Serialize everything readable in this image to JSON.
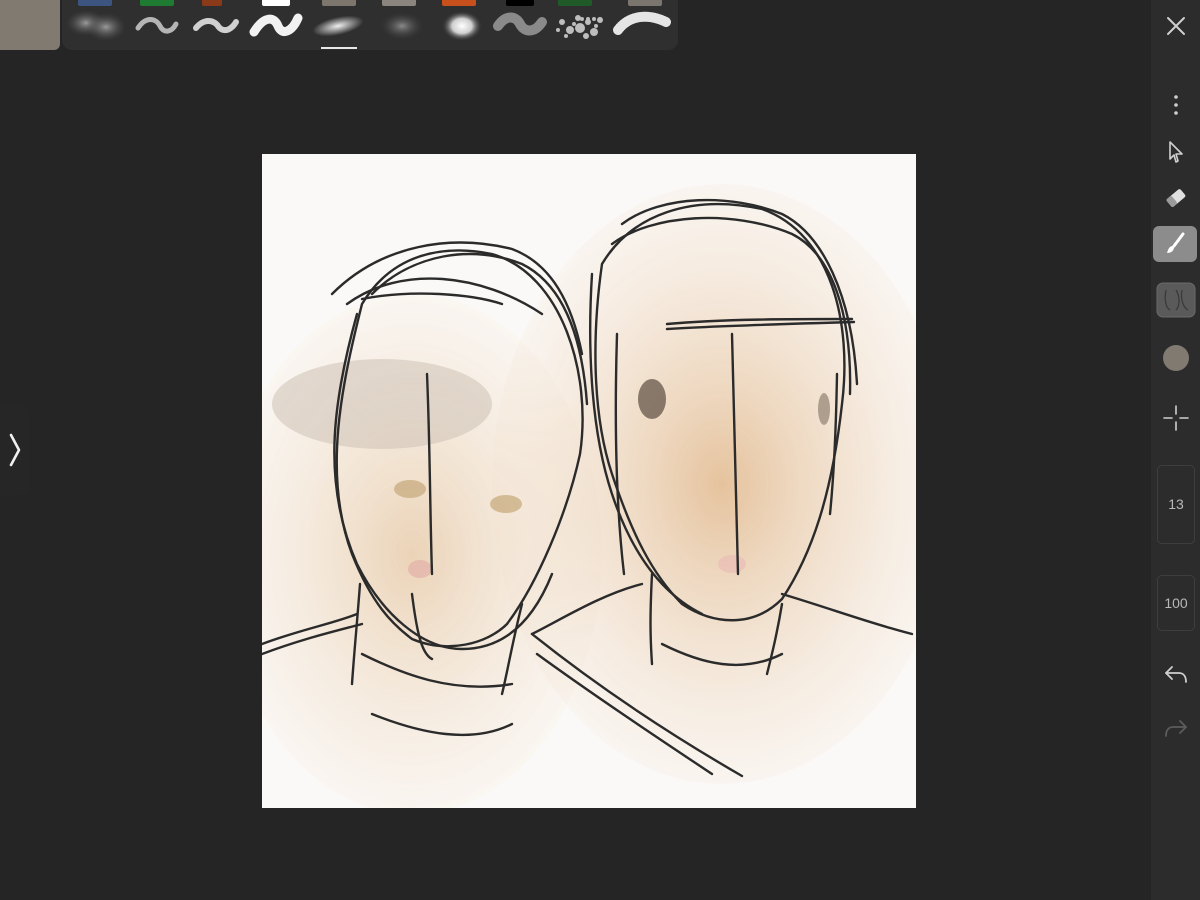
{
  "colors": {
    "app_background": "#252525",
    "current_color": "#817a71",
    "toolbar_background": "#2c2c2c",
    "canvas_background": "#fbf9f7",
    "stroke_color": "#2b2b2b",
    "active_tool_background": "#8c8c8c"
  },
  "top_bar": {
    "current_color_swatch": "#817a71",
    "palette_swatches": [
      "#3b5580",
      "#1f7a32",
      "#8a3a18",
      "#ffffff",
      "#7d766d",
      "#8a857e",
      "#c8501c",
      "#000000",
      "#1f5a28",
      "#7a756f"
    ],
    "brushes": [
      {
        "name": "airbrush-soft",
        "icon": "soft-blob-icon"
      },
      {
        "name": "pencil",
        "icon": "wave-stroke-icon"
      },
      {
        "name": "chalk",
        "icon": "textured-wave-icon"
      },
      {
        "name": "marker",
        "icon": "bold-wave-icon"
      },
      {
        "name": "spray",
        "icon": "spray-stroke-icon",
        "selected": true
      },
      {
        "name": "blur",
        "icon": "blur-blob-icon"
      },
      {
        "name": "glow",
        "icon": "glow-blob-icon"
      },
      {
        "name": "smudge",
        "icon": "smudge-wave-icon"
      },
      {
        "name": "splatter",
        "icon": "splatter-icon"
      },
      {
        "name": "dry-brush",
        "icon": "dry-brush-icon"
      }
    ]
  },
  "left_drawer": {
    "icon": "chevron-right-icon"
  },
  "right_toolbar": {
    "close_icon": "close-icon",
    "more_icon": "more-vertical-icon",
    "select_icon": "cursor-icon",
    "eraser_icon": "eraser-icon",
    "brush_icon": "brush-icon",
    "layer_icon": "layer-thumbnail-icon",
    "color_icon": "color-circle-icon",
    "transform_icon": "crosshair-icon",
    "brush_size": "13",
    "opacity": "100",
    "undo_icon": "undo-icon",
    "redo_icon": "redo-icon"
  }
}
